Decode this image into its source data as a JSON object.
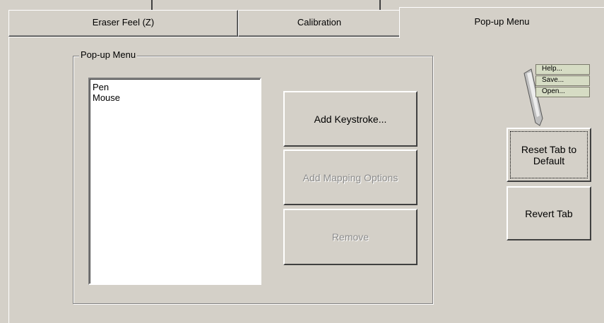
{
  "tabs": [
    {
      "label": "Eraser Feel (Z)",
      "active": false
    },
    {
      "label": "Calibration",
      "active": false
    },
    {
      "label": "Pop-up Menu",
      "active": true
    }
  ],
  "groupbox": {
    "title": "Pop-up Menu"
  },
  "list": {
    "items": [
      "Pen",
      "Mouse"
    ]
  },
  "buttons": {
    "add_keystroke": "Add Keystroke...",
    "add_mapping_options": "Add Mapping Options",
    "remove": "Remove",
    "reset_tab": "Reset Tab to Default",
    "revert_tab": "Revert Tab"
  },
  "help_widget": {
    "items": [
      "Help...",
      "Save...",
      "Open..."
    ]
  }
}
